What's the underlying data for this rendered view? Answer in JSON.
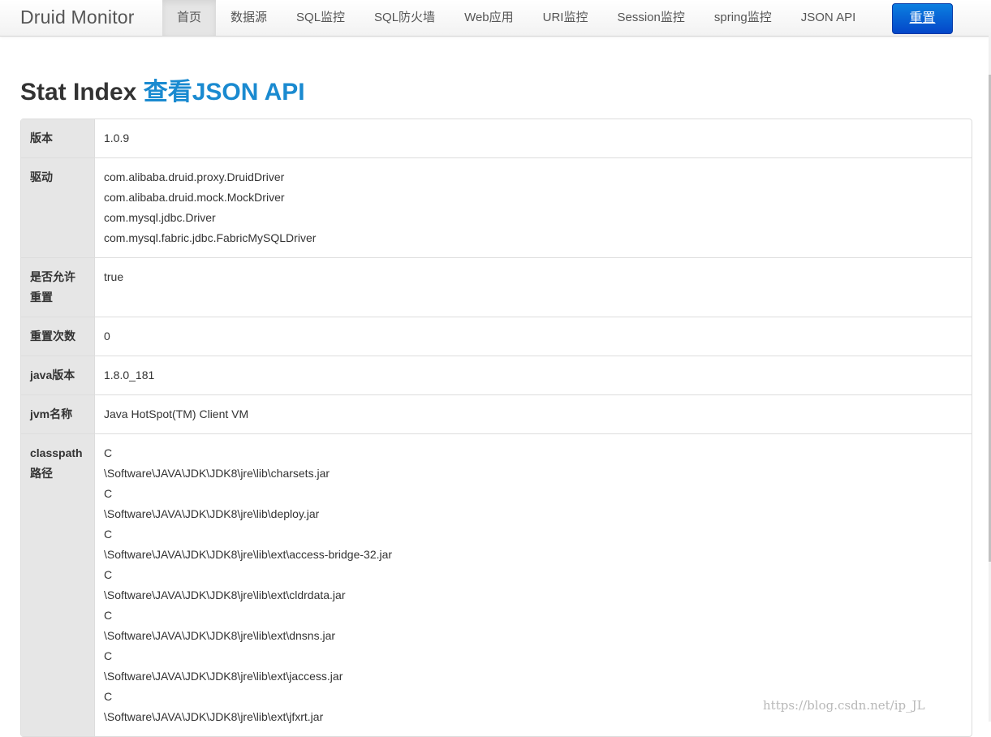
{
  "navbar": {
    "brand": "Druid Monitor",
    "items": [
      {
        "label": "首页",
        "active": true
      },
      {
        "label": "数据源"
      },
      {
        "label": "SQL监控"
      },
      {
        "label": "SQL防火墙"
      },
      {
        "label": "Web应用"
      },
      {
        "label": "URI监控"
      },
      {
        "label": "Session监控"
      },
      {
        "label": "spring监控"
      },
      {
        "label": "JSON API"
      }
    ],
    "reset_label": "重置"
  },
  "page": {
    "title": "Stat Index",
    "json_link": "查看JSON API"
  },
  "table": [
    {
      "label": "版本",
      "lines": [
        "1.0.9"
      ]
    },
    {
      "label": "驱动",
      "lines": [
        "com.alibaba.druid.proxy.DruidDriver",
        "com.alibaba.druid.mock.MockDriver",
        "com.mysql.jdbc.Driver",
        "com.mysql.fabric.jdbc.FabricMySQLDriver"
      ]
    },
    {
      "label": "是否允许重置",
      "lines": [
        "true"
      ]
    },
    {
      "label": "重置次数",
      "lines": [
        "0"
      ]
    },
    {
      "label": "java版本",
      "lines": [
        "1.8.0_181"
      ]
    },
    {
      "label": "jvm名称",
      "lines": [
        "Java HotSpot(TM) Client VM"
      ]
    },
    {
      "label": "classpath路径",
      "lines": [
        "C",
        "\\Software\\JAVA\\JDK\\JDK8\\jre\\lib\\charsets.jar",
        "C",
        "\\Software\\JAVA\\JDK\\JDK8\\jre\\lib\\deploy.jar",
        "C",
        "\\Software\\JAVA\\JDK\\JDK8\\jre\\lib\\ext\\access-bridge-32.jar",
        "C",
        "\\Software\\JAVA\\JDK\\JDK8\\jre\\lib\\ext\\cldrdata.jar",
        "C",
        "\\Software\\JAVA\\JDK\\JDK8\\jre\\lib\\ext\\dnsns.jar",
        "C",
        "\\Software\\JAVA\\JDK\\JDK8\\jre\\lib\\ext\\jaccess.jar",
        "C",
        "\\Software\\JAVA\\JDK\\JDK8\\jre\\lib\\ext\\jfxrt.jar"
      ]
    }
  ],
  "watermark": "https://blog.csdn.net/ip_JL"
}
